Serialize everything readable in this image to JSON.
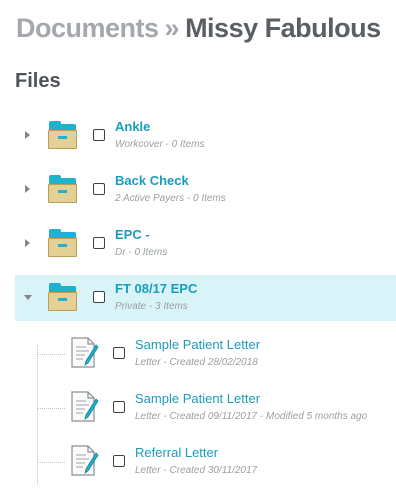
{
  "breadcrumb": {
    "root": "Documents",
    "separator": "»",
    "current": "Missy Fabulous"
  },
  "section_title": "Files",
  "folders": [
    {
      "title": "Ankle",
      "subtitle": "Workcover - 0 Items",
      "expanded": false,
      "icon": "folder-icon"
    },
    {
      "title": "Back Check",
      "subtitle": "2 Active Payers - 0 Items",
      "expanded": false,
      "icon": "folder-icon"
    },
    {
      "title": "EPC -",
      "subtitle": "Dr - 0 Items",
      "expanded": false,
      "icon": "folder-icon"
    },
    {
      "title": "FT 08/17 EPC",
      "subtitle": "Private - 3 Items",
      "expanded": true,
      "icon": "folder-icon"
    }
  ],
  "documents": [
    {
      "title": "Sample Patient Letter",
      "subtitle": "Letter - Created 28/02/2018",
      "icon": "letter-document-icon"
    },
    {
      "title": "Sample Patient Letter",
      "subtitle": "Letter - Created 09/11/2017 - Modified 5 months ago",
      "icon": "letter-document-icon"
    },
    {
      "title": "Referral Letter",
      "subtitle": "Letter - Created 30/11/2017",
      "icon": "letter-document-icon"
    }
  ],
  "colors": {
    "accent": "#1a9cbd",
    "selected_row": "#d9f4f8",
    "folder_body": "#e4cf94",
    "folder_tab": "#1eb2cf"
  }
}
